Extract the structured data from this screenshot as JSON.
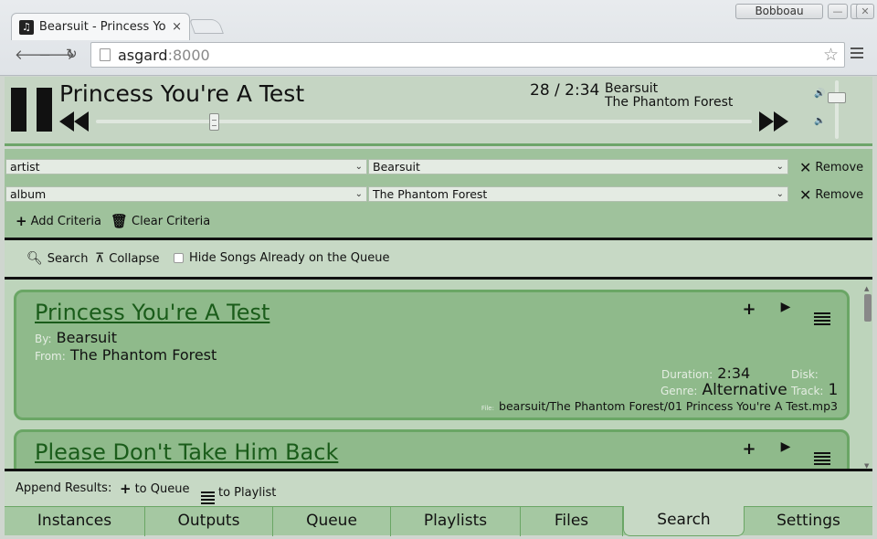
{
  "browser": {
    "tab_title": "Bearsuit - Princess You'",
    "tab_close": "×",
    "profile_name": "Bobboau",
    "url_host": "asgard",
    "url_port": ":8000"
  },
  "player": {
    "title": "Princess You're A Test",
    "time": "28 / 2:34",
    "artist": "Bearsuit",
    "album": "The Phantom Forest",
    "progress_fraction": 0.18,
    "volume_fraction": 0.7
  },
  "criteria": {
    "rows": [
      {
        "field": "artist",
        "value": "Bearsuit",
        "remove_label": "Remove"
      },
      {
        "field": "album",
        "value": "The Phantom Forest",
        "remove_label": "Remove"
      }
    ],
    "add_label": "Add Criteria",
    "clear_label": "Clear Criteria"
  },
  "toolbar": {
    "search_label": "Search",
    "collapse_label": "Collapse",
    "hide_label": "Hide Songs Already on the Queue"
  },
  "results": [
    {
      "title": "Princess You're A Test",
      "by_label": "By:",
      "artist": "Bearsuit",
      "from_label": "From:",
      "album": "The Phantom Forest",
      "duration_label": "Duration:",
      "duration": "2:34",
      "disk_label": "Disk:",
      "genre_label": "Genre:",
      "genre": "Alternative",
      "track_label": "Track:",
      "track": "1",
      "file_label": "File:",
      "file": "bearsuit/The Phantom Forest/01 Princess You're A Test.mp3"
    },
    {
      "title": "Please Don't Take Him Back"
    }
  ],
  "append": {
    "label": "Append Results:",
    "queue_label": "to Queue",
    "playlist_label": "to Playlist"
  },
  "tabs": [
    "Instances",
    "Outputs",
    "Queue",
    "Playlists",
    "Files",
    "Search",
    "Settings"
  ],
  "active_tab": "Search"
}
